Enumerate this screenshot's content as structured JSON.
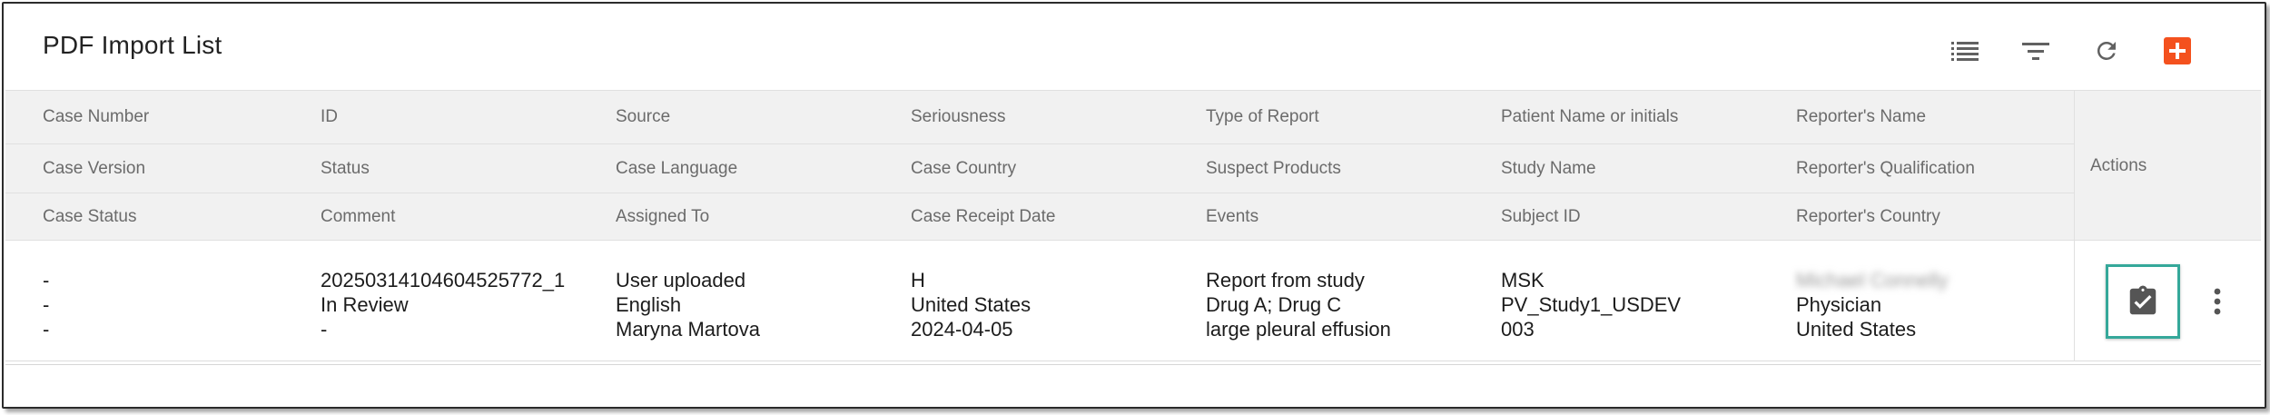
{
  "page": {
    "title": "PDF Import List"
  },
  "toolbar": {
    "icons": [
      "list-view-icon",
      "filter-icon",
      "refresh-icon",
      "add-icon"
    ],
    "add_color": "#f4511e"
  },
  "table": {
    "header_row1": [
      "Case Number",
      "ID",
      "Source",
      "Seriousness",
      "Type of Report",
      "Patient Name or initials",
      "Reporter's Name"
    ],
    "header_row2": [
      "Case Version",
      "Status",
      "Case Language",
      "Case Country",
      "Suspect Products",
      "Study Name",
      "Reporter's Qualification"
    ],
    "header_row3": [
      "Case Status",
      "Comment",
      "Assigned To",
      "Case Receipt Date",
      "Events",
      "Subject ID",
      "Reporter's Country"
    ],
    "actions_header": "Actions",
    "rows": [
      {
        "col1": [
          "-",
          "-",
          "-"
        ],
        "col2": [
          "20250314104604525772_1",
          "In Review",
          "-"
        ],
        "col3": [
          "User uploaded",
          "English",
          "Maryna Martova"
        ],
        "col4": [
          "H",
          "United States",
          "2024-04-05"
        ],
        "col5": [
          "Report from study",
          "Drug A; Drug C",
          "large pleural effusion"
        ],
        "col6": [
          "MSK",
          "PV_Study1_USDEV",
          "003"
        ],
        "col7": [
          "Michael Connelly",
          "Physician",
          "United States"
        ]
      }
    ]
  },
  "colors": {
    "header_bg": "#f1f1f1",
    "header_text": "#6b6b6b",
    "highlight_border": "#35a89a",
    "icon_gray": "#616161"
  }
}
